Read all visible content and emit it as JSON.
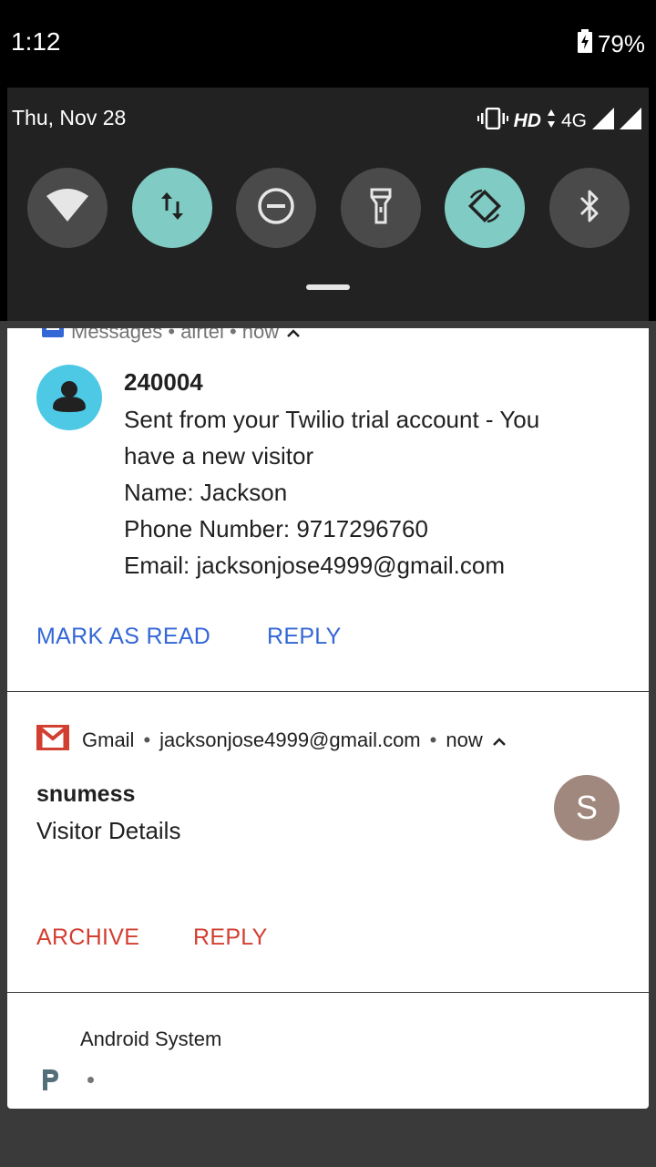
{
  "status_bar": {
    "time": "1:12",
    "battery": "79%"
  },
  "quick_settings": {
    "date": "Thu, Nov 28",
    "network_hd": "HD",
    "network_type": "4G",
    "tiles": [
      {
        "name": "wifi",
        "state": "off"
      },
      {
        "name": "mobile-data",
        "state": "on"
      },
      {
        "name": "do-not-disturb",
        "state": "off"
      },
      {
        "name": "flashlight",
        "state": "off"
      },
      {
        "name": "auto-rotate",
        "state": "on"
      },
      {
        "name": "bluetooth",
        "state": "off"
      }
    ]
  },
  "notifications": {
    "messages": {
      "header": "Messages • airtel • now",
      "sender": "240004",
      "lines": [
        "Sent from your Twilio trial account - You",
        "have a new visitor",
        "Name: Jackson",
        "Phone Number: 9717296760",
        "Email: jacksonjose4999@gmail.com"
      ],
      "actions": [
        "MARK AS READ",
        "REPLY"
      ]
    },
    "gmail": {
      "app": "Gmail",
      "account": "jacksonjose4999@gmail.com",
      "time": "now",
      "sender": "snumess",
      "subject": "Visitor Details",
      "avatar_letter": "S",
      "actions": [
        "ARCHIVE",
        "REPLY"
      ]
    },
    "android_system": {
      "title": "Android System"
    }
  },
  "colors": {
    "accent_blue": "#3367d6",
    "accent_red": "#d23f31",
    "tile_on": "#80cbc4"
  }
}
